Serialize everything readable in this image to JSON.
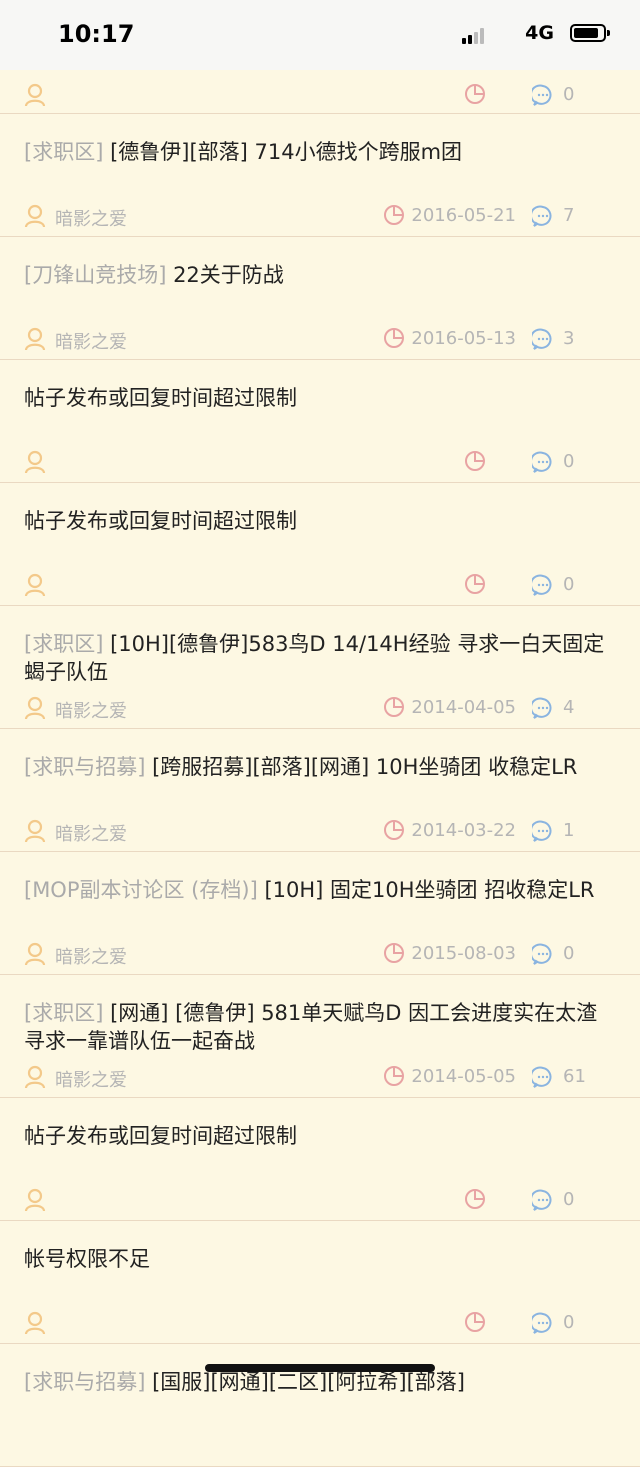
{
  "status_bar": {
    "time": "10:17",
    "network": "4G"
  },
  "posts": [
    {
      "category": "",
      "title": "",
      "author": "",
      "date": "",
      "replies": "0"
    },
    {
      "category": "[求职区]",
      "title": " [德鲁伊][部落] 714小德找个跨服m团",
      "author": "暗影之爱",
      "date": "2016-05-21",
      "replies": "7"
    },
    {
      "category": "[刀锋山竞技场]",
      "title": " 22关于防战",
      "author": "暗影之爱",
      "date": "2016-05-13",
      "replies": "3"
    },
    {
      "category": "",
      "title": "帖子发布或回复时间超过限制",
      "author": "",
      "date": "",
      "replies": "0"
    },
    {
      "category": "",
      "title": "帖子发布或回复时间超过限制",
      "author": "",
      "date": "",
      "replies": "0"
    },
    {
      "category": "[求职区]",
      "title": " [10H][德鲁伊]583鸟D 14/14H经验 寻求一白天固定蝎子队伍",
      "author": "暗影之爱",
      "date": "2014-04-05",
      "replies": "4"
    },
    {
      "category": "[求职与招募]",
      "title": " [跨服招募][部落][网通] 10H坐骑团 收稳定LR",
      "author": "暗影之爱",
      "date": "2014-03-22",
      "replies": "1"
    },
    {
      "category": "[MOP副本讨论区 (存档)]",
      "title": " [10H] 固定10H坐骑团 招收稳定LR",
      "author": "暗影之爱",
      "date": "2015-08-03",
      "replies": "0"
    },
    {
      "category": "[求职区]",
      "title": " [网通] [德鲁伊] 581单天赋鸟D  因工会进度实在太渣  寻求一靠谱队伍一起奋战",
      "author": "暗影之爱",
      "date": "2014-05-05",
      "replies": "61"
    },
    {
      "category": "",
      "title": "帖子发布或回复时间超过限制",
      "author": "",
      "date": "",
      "replies": "0"
    },
    {
      "category": "",
      "title": "帐号权限不足",
      "author": "",
      "date": "",
      "replies": "0"
    },
    {
      "category": "[求职与招募]",
      "title": " [国服][网通][二区][阿拉希][部落]",
      "author": "",
      "date": "",
      "replies": ""
    }
  ],
  "colors": {
    "background": "#fdf8e3",
    "divider": "#ead9c2",
    "user_icon": "#f3c98a",
    "clock_icon": "#e8a3a3",
    "comment_icon": "#8ab4e0",
    "meta_text": "#b5b5b5"
  }
}
